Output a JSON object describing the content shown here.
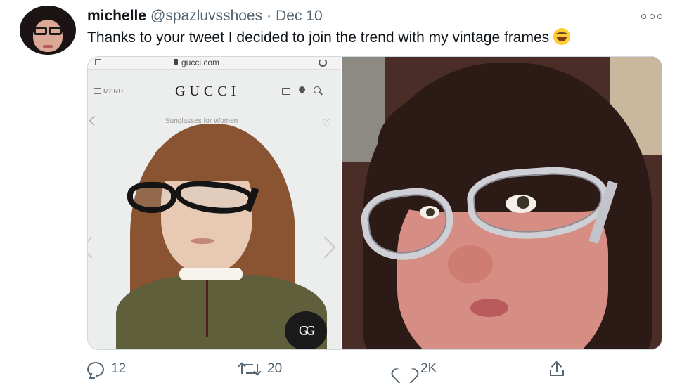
{
  "tweet": {
    "author_name": "michelle",
    "handle": "@spazluvsshoes",
    "separator": "·",
    "date": "Dec 10",
    "text": "Thanks to your tweet I decided to join the trend with my vintage frames",
    "emoji_icon": "rolling-on-floor-laughing-emoji"
  },
  "media": {
    "left_image": {
      "url": "gucci.com",
      "menu_label": "MENU",
      "brand": "GUCCI",
      "subtitle": "Sunglasses for Women",
      "badge": "GG",
      "icons": [
        "lock-icon",
        "reload-icon",
        "menu-icon",
        "bag-icon",
        "pin-icon",
        "search-icon",
        "back-icon",
        "heart-icon",
        "chevron-left-icon",
        "chevron-right-icon"
      ]
    },
    "right_image": {
      "description_icon": "selfie-photo"
    }
  },
  "actions": {
    "reply_count": "12",
    "retweet_count": "20",
    "like_count": "2K"
  },
  "colors": {
    "text_primary": "#0f1419",
    "text_secondary": "#536471",
    "border": "#cfd9de"
  }
}
